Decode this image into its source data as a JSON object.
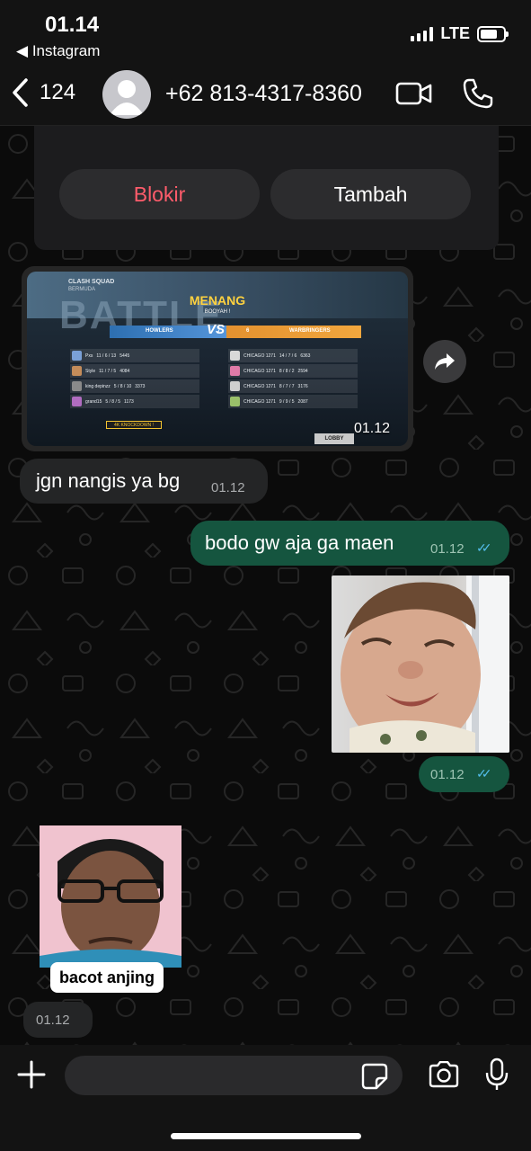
{
  "status_bar": {
    "time": "01.14",
    "back_app": "Instagram",
    "network": "LTE",
    "battery_level": 0.75
  },
  "header": {
    "back_count": "124",
    "contact_name": "+62 813-4317-8360"
  },
  "block_card": {
    "block_label": "Blokir",
    "add_label": "Tambah"
  },
  "game_screenshot": {
    "mode": "CLASH SQUAD",
    "map": "BERMUDA",
    "backdrop_text": "BATTLE",
    "result": "MENANG",
    "subtitle": "BOOYAH !",
    "team_left": "HOWLERS",
    "team_right": "WARBRINGERS",
    "score_left": "7",
    "score_right": "6",
    "versus": "VS",
    "left_players": [
      {
        "name": "Pxs",
        "stats": "11 / 6 / 13",
        "dmg": "5445"
      },
      {
        "name": "Style",
        "stats": "11 / 7 / 5",
        "dmg": "4084"
      },
      {
        "name": "king depinzz",
        "stats": "5 / 8 / 10",
        "dmg": "3373"
      },
      {
        "name": "grand15",
        "stats": "5 / 8 / 5",
        "dmg": "1173"
      }
    ],
    "right_players": [
      {
        "name": "CHICAGO 1271",
        "stats": "14 / 7 / 6",
        "dmg": "6363"
      },
      {
        "name": "CHICAGO 1271",
        "stats": "8 / 8 / 2",
        "dmg": "2594"
      },
      {
        "name": "CHICAGO 1271",
        "stats": "8 / 7 / 7",
        "dmg": "3176"
      },
      {
        "name": "CHICAGO 1271",
        "stats": "9 / 9 / 5",
        "dmg": "2087"
      }
    ],
    "knockdown_tag": "4K KNOCKDOWN !",
    "lobby_label": "LOBBY"
  },
  "messages": [
    {
      "type": "image",
      "direction": "in",
      "time": "01.12"
    },
    {
      "type": "text",
      "direction": "in",
      "text": "jgn nangis ya bg",
      "time": "01.12"
    },
    {
      "type": "text",
      "direction": "out",
      "text": "bodo gw aja ga maen",
      "time": "01.12"
    },
    {
      "type": "image",
      "direction": "out",
      "time": "01.12"
    },
    {
      "type": "sticker",
      "direction": "in",
      "caption": "bacot anjing",
      "time": "01.12"
    }
  ],
  "input": {
    "value": "",
    "placeholder": ""
  },
  "colors": {
    "bubble_in": "#242526",
    "bubble_out": "#15553f",
    "read_ticks": "#53bdeb",
    "block_red": "#ff5c6b"
  },
  "icons": [
    "back-chevron-icon",
    "avatar-icon",
    "video-call-icon",
    "phone-icon",
    "forward-icon",
    "plus-icon",
    "sticker-icon",
    "camera-icon",
    "mic-icon"
  ]
}
